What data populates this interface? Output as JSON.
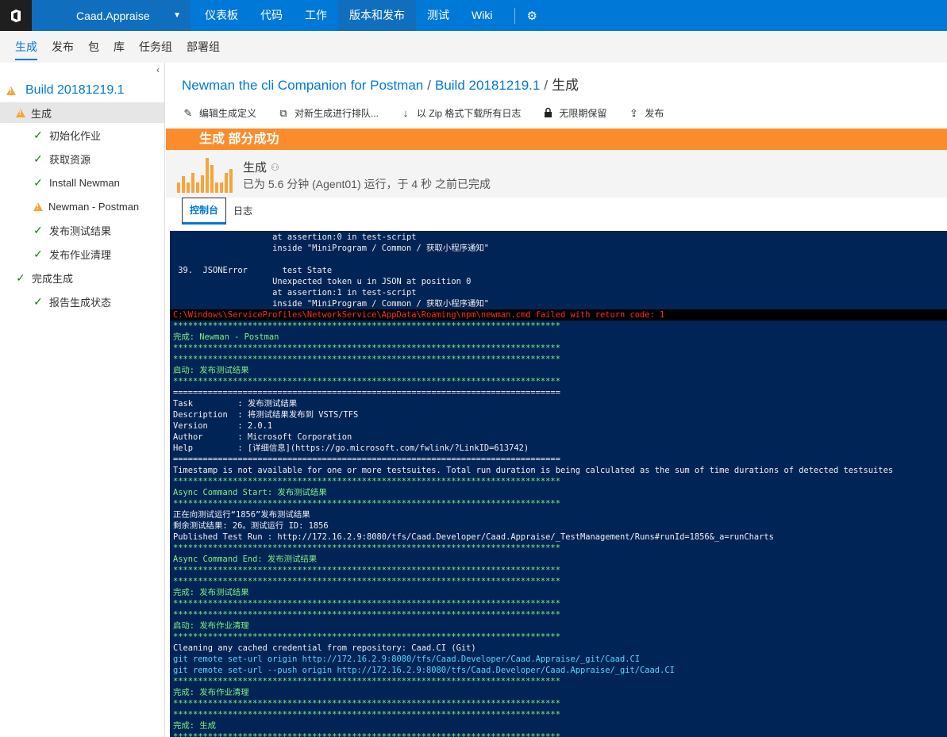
{
  "topbar": {
    "project": "Caad.Appraise",
    "nav": [
      "仪表板",
      "代码",
      "工作",
      "版本和发布",
      "测试",
      "Wiki"
    ],
    "active_nav": "版本和发布"
  },
  "subnav": {
    "items": [
      "生成",
      "发布",
      "包",
      "库",
      "任务组",
      "部署组"
    ],
    "active": "生成"
  },
  "sidebar": {
    "build": "Build 20181219.1",
    "items": [
      {
        "label": "生成",
        "status": "warning",
        "level": 0,
        "selected": true
      },
      {
        "label": "初始化作业",
        "status": "success",
        "level": 1
      },
      {
        "label": "获取资源",
        "status": "success",
        "level": 1
      },
      {
        "label": "Install Newman",
        "status": "success",
        "level": 1
      },
      {
        "label": "Newman - Postman",
        "status": "warning",
        "level": 1
      },
      {
        "label": "发布测试结果",
        "status": "success",
        "level": 1
      },
      {
        "label": "发布作业清理",
        "status": "success",
        "level": 1
      },
      {
        "label": "完成生成",
        "status": "success",
        "level": 0
      },
      {
        "label": "报告生成状态",
        "status": "success",
        "level": 1
      }
    ]
  },
  "breadcrumb": {
    "p1": "Newman the cli Companion for Postman",
    "p2": "Build 20181219.1",
    "p3": "生成"
  },
  "toolbar": {
    "edit": "编辑生成定义",
    "queue": "对新生成进行排队...",
    "download": "以 Zip 格式下载所有日志",
    "retain": "无限期保留",
    "release": "发布"
  },
  "banner": "生成 部分成功",
  "summary": {
    "title": "生成",
    "subtitle": "已为 5.6 分钟 (Agent01) 运行，于 4 秒 之前已完成",
    "history_bars": [
      0.28,
      0.45,
      0.28,
      0.55,
      0.28,
      0.48,
      0.95,
      0.75,
      0.28,
      0.28,
      0.55,
      0.65
    ],
    "color": "#f7a43a"
  },
  "tabs": {
    "console": "控制台",
    "log": "日志"
  },
  "console": [
    {
      "t": "                    at assertion:0 in test-script",
      "c": "white"
    },
    {
      "t": "                    inside \"MiniProgram / Common / 获取小程序通知\"",
      "c": "white"
    },
    {
      "t": "",
      "c": "white"
    },
    {
      "t": " 39.  JSONError       test State",
      "c": "white"
    },
    {
      "t": "                    Unexpected token u in JSON at position 0",
      "c": "white"
    },
    {
      "t": "                    at assertion:1 in test-script",
      "c": "white"
    },
    {
      "t": "                    inside \"MiniProgram / Common / 获取小程序通知\"",
      "c": "white"
    },
    {
      "t": "C:\\Windows\\ServiceProfiles\\NetworkService\\AppData\\Roaming\\npm\\newman.cmd failed with return code: 1",
      "c": "red"
    },
    {
      "t": "******************************************************************************",
      "c": "green"
    },
    {
      "t": "完成: Newman - Postman",
      "c": "green"
    },
    {
      "t": "******************************************************************************",
      "c": "green"
    },
    {
      "t": "******************************************************************************",
      "c": "green"
    },
    {
      "t": "启动: 发布测试结果",
      "c": "green"
    },
    {
      "t": "******************************************************************************",
      "c": "green"
    },
    {
      "t": "==============================================================================",
      "c": "white"
    },
    {
      "t": "Task         : 发布测试结果",
      "c": "white"
    },
    {
      "t": "Description  : 将测试结果发布到 VSTS/TFS",
      "c": "white"
    },
    {
      "t": "Version      : 2.0.1",
      "c": "white"
    },
    {
      "t": "Author       : Microsoft Corporation",
      "c": "white"
    },
    {
      "t": "Help         : [详细信息](https://go.microsoft.com/fwlink/?LinkID=613742)",
      "c": "white"
    },
    {
      "t": "==============================================================================",
      "c": "white"
    },
    {
      "t": "Timestamp is not available for one or more testsuites. Total run duration is being calculated as the sum of time durations of detected testsuites",
      "c": "white"
    },
    {
      "t": "******************************************************************************",
      "c": "green"
    },
    {
      "t": "Async Command Start: 发布测试结果",
      "c": "green"
    },
    {
      "t": "******************************************************************************",
      "c": "green"
    },
    {
      "t": "正在向测试运行“1856”发布测试结果",
      "c": "white"
    },
    {
      "t": "剩余测试结果: 26。测试运行 ID: 1856",
      "c": "white"
    },
    {
      "t": "Published Test Run : http://172.16.2.9:8080/tfs/Caad.Developer/Caad.Appraise/_TestManagement/Runs#runId=1856&_a=runCharts",
      "c": "white"
    },
    {
      "t": "******************************************************************************",
      "c": "green"
    },
    {
      "t": "Async Command End: 发布测试结果",
      "c": "green"
    },
    {
      "t": "******************************************************************************",
      "c": "green"
    },
    {
      "t": "******************************************************************************",
      "c": "green"
    },
    {
      "t": "完成: 发布测试结果",
      "c": "green"
    },
    {
      "t": "******************************************************************************",
      "c": "green"
    },
    {
      "t": "******************************************************************************",
      "c": "green"
    },
    {
      "t": "启动: 发布作业清理",
      "c": "green"
    },
    {
      "t": "******************************************************************************",
      "c": "green"
    },
    {
      "t": "Cleaning any cached credential from repository: Caad.CI (Git)",
      "c": "white"
    },
    {
      "t": "git remote set-url origin http://172.16.2.9:8080/tfs/Caad.Developer/Caad.Appraise/_git/Caad.CI",
      "c": "cyan"
    },
    {
      "t": "git remote set-url --push origin http://172.16.2.9:8080/tfs/Caad.Developer/Caad.Appraise/_git/Caad.CI",
      "c": "cyan"
    },
    {
      "t": "******************************************************************************",
      "c": "green"
    },
    {
      "t": "完成: 发布作业清理",
      "c": "green"
    },
    {
      "t": "******************************************************************************",
      "c": "green"
    },
    {
      "t": "******************************************************************************",
      "c": "green"
    },
    {
      "t": "完成: 生成",
      "c": "green"
    },
    {
      "t": "******************************************************************************",
      "c": "green"
    }
  ]
}
